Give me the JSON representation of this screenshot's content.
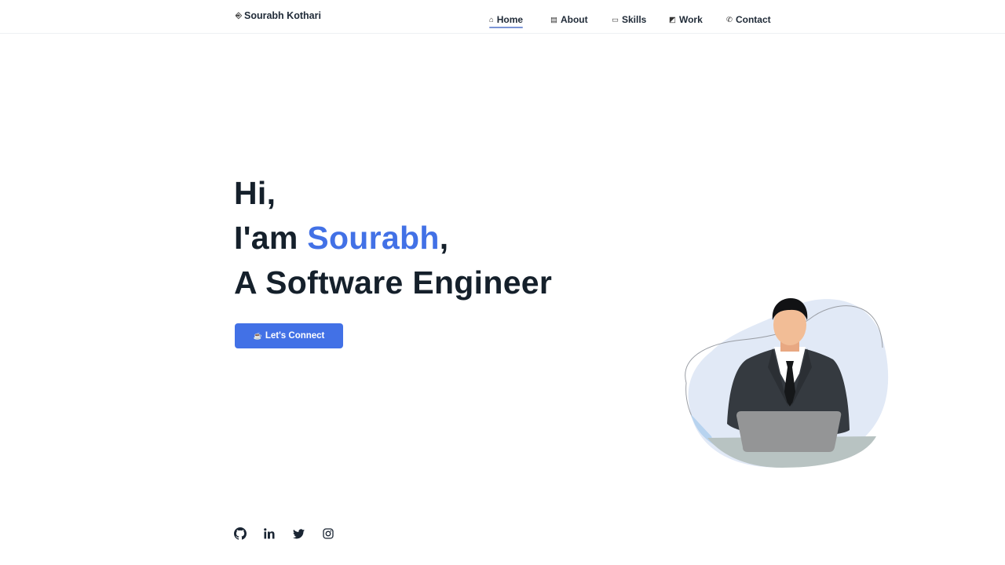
{
  "header": {
    "logo": {
      "icon": "login-icon",
      "icon_glyph": "⎆",
      "text": "Sourabh Kothari"
    },
    "nav": [
      {
        "label": "Home",
        "icon": "home-icon",
        "glyph": "⌂",
        "active": true
      },
      {
        "label": "About",
        "icon": "document-icon",
        "glyph": "▤",
        "active": false
      },
      {
        "label": "Skills",
        "icon": "laptop-icon",
        "glyph": "▭",
        "active": false
      },
      {
        "label": "Work",
        "icon": "image-icon",
        "glyph": "◩",
        "active": false
      },
      {
        "label": "Contact",
        "icon": "phone-icon",
        "glyph": "✆",
        "active": false
      }
    ]
  },
  "hero": {
    "line1": "Hi,",
    "line2_prefix": "I'am ",
    "line2_name": "Sourabh",
    "line2_suffix": ",",
    "line3": "A Software Engineer",
    "accent_color": "#4271e6"
  },
  "cta": {
    "label": "Let's Connect",
    "icon": "coffee-icon",
    "glyph": "☕"
  },
  "socials": [
    {
      "name": "github-icon",
      "label": "GitHub"
    },
    {
      "name": "linkedin-icon",
      "label": "LinkedIn"
    },
    {
      "name": "twitter-icon",
      "label": "Twitter"
    },
    {
      "name": "instagram-icon",
      "label": "Instagram"
    }
  ],
  "illustration": {
    "description": "Man in suit working on laptop"
  }
}
